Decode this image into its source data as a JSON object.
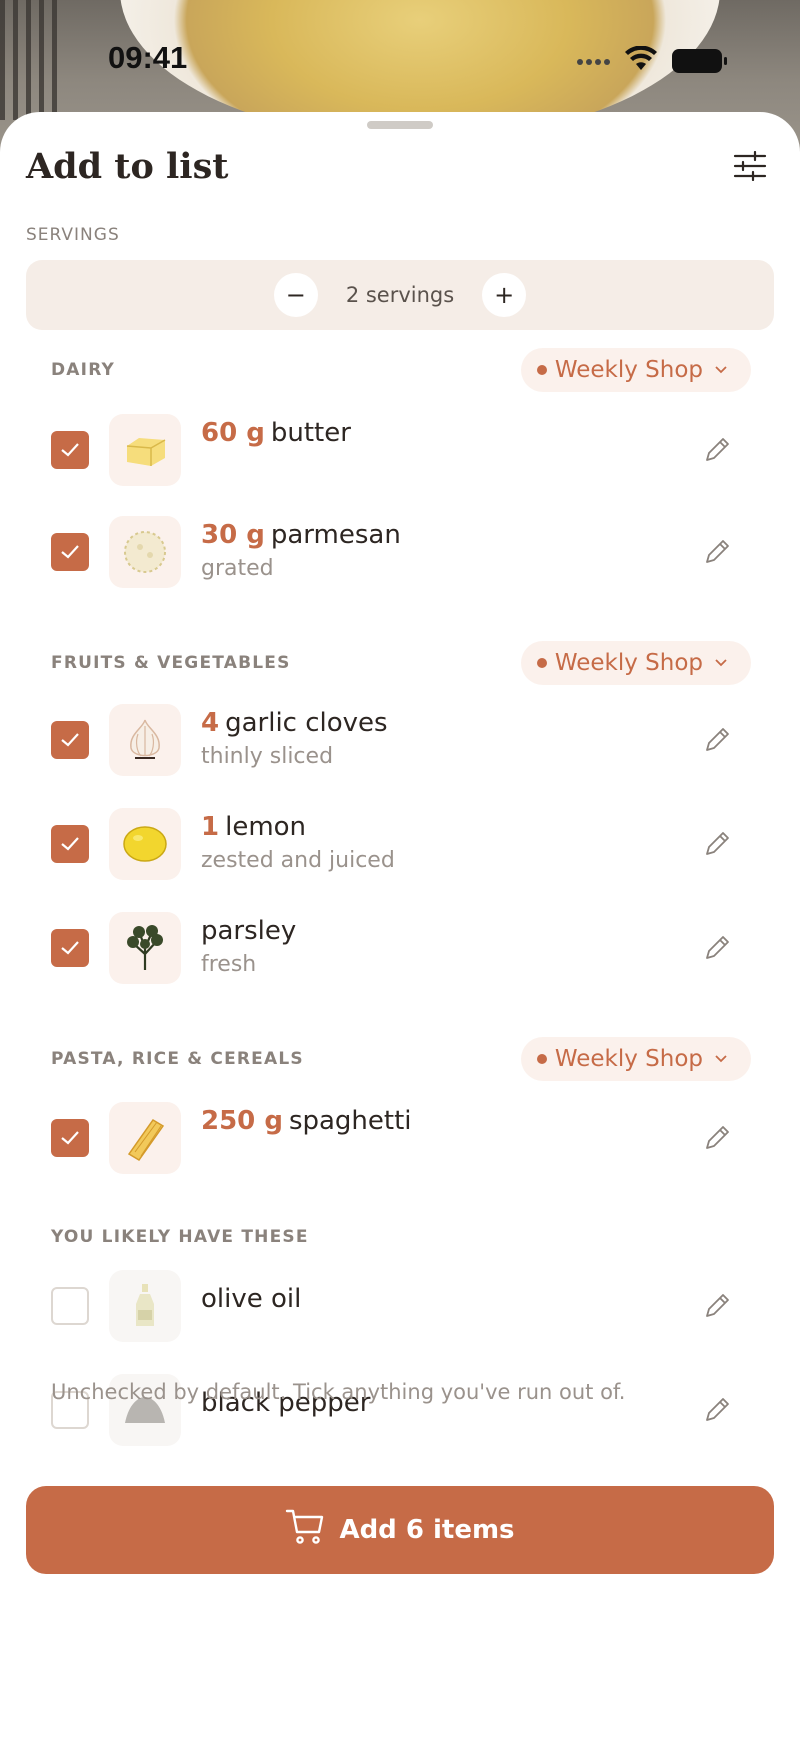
{
  "status_bar": {
    "time": "09:41"
  },
  "sheet": {
    "title": "Add to list",
    "servings_label": "SERVINGS",
    "servings_value": "2 servings",
    "decrement_symbol": "−",
    "increment_symbol": "+"
  },
  "sections": [
    {
      "title": "DAIRY",
      "list_chip": "Weekly Shop",
      "items": [
        {
          "qty": "60 g",
          "name": "butter",
          "note": "",
          "checked": true,
          "icon": "butter-icon"
        },
        {
          "qty": "30 g",
          "name": "parmesan",
          "note": "grated",
          "checked": true,
          "icon": "parmesan-icon"
        }
      ]
    },
    {
      "title": "FRUITS & VEGETABLES",
      "list_chip": "Weekly Shop",
      "items": [
        {
          "qty": "4",
          "name": "garlic cloves",
          "note": "thinly sliced",
          "checked": true,
          "icon": "garlic-icon"
        },
        {
          "qty": "1",
          "name": "lemon",
          "note": "zested and juiced",
          "checked": true,
          "icon": "lemon-icon"
        },
        {
          "qty": "",
          "name": "parsley",
          "note": "fresh",
          "checked": true,
          "icon": "parsley-icon"
        }
      ]
    },
    {
      "title": "PASTA, RICE & CEREALS",
      "list_chip": "Weekly Shop",
      "items": [
        {
          "qty": "250 g",
          "name": "spaghetti",
          "note": "",
          "checked": true,
          "icon": "spaghetti-icon"
        }
      ]
    },
    {
      "title": "YOU LIKELY HAVE THESE",
      "items": [
        {
          "qty": "",
          "name": "olive oil",
          "note": "",
          "checked": false,
          "icon": "olive-oil-icon"
        },
        {
          "qty": "",
          "name": "black pepper",
          "note": "",
          "checked": false,
          "icon": "black-pepper-icon"
        }
      ]
    }
  ],
  "footer_note": "Unchecked by default. Tick anything you've run out of.",
  "cta": {
    "label": "Add 6 items"
  },
  "colors": {
    "accent": "#c66b47",
    "chip_bg": "#fbf1ec",
    "servings_bg": "#f5ede7"
  }
}
